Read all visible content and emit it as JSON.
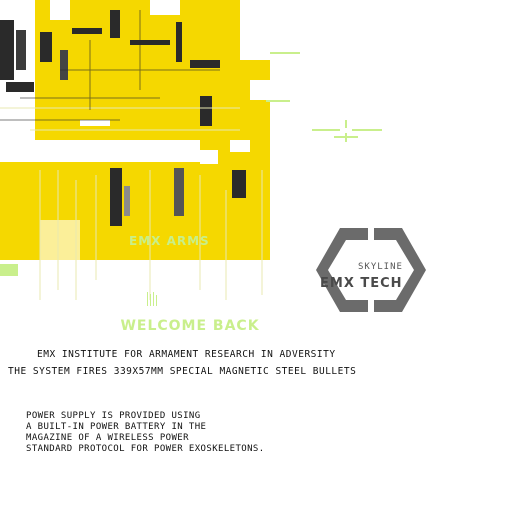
{
  "top_graphic": {
    "label": "EMX ARMS"
  },
  "logo": {
    "subtitle": "SKYLINE",
    "brand": "EMX TECH"
  },
  "main": {
    "welcome": "WELCOME BACK",
    "institute": "EMX INSTITUTE FOR ARMAMENT RESEARCH IN ADVERSITY",
    "system": "THE SYSTEM FIRES 339X57MM SPECIAL MAGNETIC STEEL BULLETS"
  },
  "description": {
    "lines": [
      "POWER SUPPLY IS PROVIDED USING",
      "A BUILT-IN POWER BATTERY IN THE",
      "MAGAZINE OF A WIRELESS POWER",
      "STANDARD PROTOCOL FOR POWER EXOSKELETONS."
    ]
  },
  "colors": {
    "accent": "#f5d800",
    "dark": "#2a2a2a",
    "green": "#c9ef8c",
    "logo_gray": "#6b6b6b"
  }
}
